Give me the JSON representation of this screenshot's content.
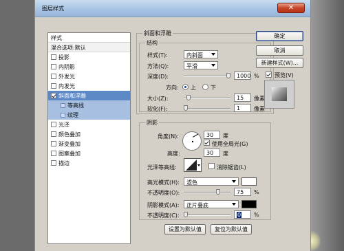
{
  "window": {
    "title": "图层样式",
    "close_glyph": "✕"
  },
  "styles_list": {
    "header": "样式",
    "blend_options": "混合选项:默认",
    "items": [
      {
        "label": "投影",
        "checked": false
      },
      {
        "label": "内阴影",
        "checked": false
      },
      {
        "label": "外发光",
        "checked": false
      },
      {
        "label": "内发光",
        "checked": false
      },
      {
        "label": "斜面和浮雕",
        "checked": true,
        "selected": true
      },
      {
        "label": "等高线",
        "sub": true
      },
      {
        "label": "纹理",
        "sub": true
      },
      {
        "label": "光泽",
        "checked": false
      },
      {
        "label": "颜色叠加",
        "checked": false
      },
      {
        "label": "渐变叠加",
        "checked": false
      },
      {
        "label": "图案叠加",
        "checked": false
      },
      {
        "label": "描边",
        "checked": false
      }
    ]
  },
  "bevel": {
    "group_title": "斜面和浮雕",
    "structure_title": "结构",
    "style_label": "样式(T):",
    "style_value": "内斜面",
    "technique_label": "方法(Q):",
    "technique_value": "平滑",
    "depth_label": "深度(D):",
    "depth_value": "1000",
    "depth_unit": "%",
    "depth_level": 1.0,
    "direction_label": "方向:",
    "dir_up": "上",
    "dir_down": "下",
    "direction": "up",
    "size_label": "大小(Z):",
    "size_value": "15",
    "size_unit": "像素",
    "size_level": 0.06,
    "soften_label": "软化(F):",
    "soften_value": "1",
    "soften_unit": "像素",
    "soften_level": 0.0
  },
  "shading": {
    "title": "阴影",
    "angle_label": "角度(N):",
    "angle_value": "30",
    "angle_unit": "度",
    "global_light_label": "使用全局光(G)",
    "global_light": true,
    "altitude_label": "高度:",
    "altitude_value": "30",
    "altitude_unit": "度",
    "gloss_label": "光泽等高线:",
    "antialias_label": "消除锯齿(L)",
    "antialias": false,
    "highlight_mode_label": "高光模式(H):",
    "highlight_mode": "滤色",
    "highlight_color": "#ffffff",
    "highlight_opacity_label": "不透明度(O):",
    "highlight_opacity": "75",
    "highlight_opacity_unit": "%",
    "highlight_opacity_level": 0.75,
    "shadow_mode_label": "阴影模式(A):",
    "shadow_mode": "正片叠底",
    "shadow_color": "#000000",
    "shadow_opacity_label": "不透明度(C):",
    "shadow_opacity": "0",
    "shadow_opacity_unit": "%",
    "shadow_opacity_level": 0.0
  },
  "footer": {
    "make_default": "设置为默认值",
    "reset_default": "复位为默认值"
  },
  "actions": {
    "ok": "确定",
    "cancel": "取消",
    "new_style": "新建样式(W)...",
    "preview": "预览(V)",
    "preview_checked": true
  }
}
